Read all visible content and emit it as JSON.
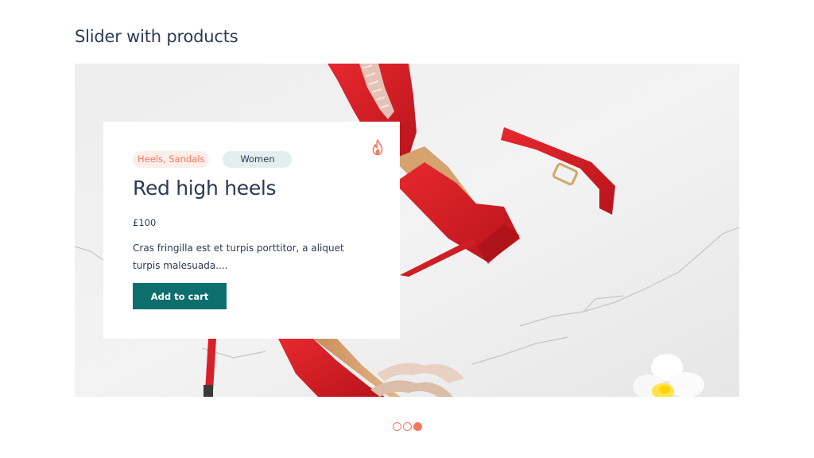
{
  "section": {
    "title": "Slider with products"
  },
  "slide": {
    "image_icon": "red-high-heels-photo",
    "product": {
      "category": "Heels, Sandals",
      "gender": "Women",
      "name": "Red high heels",
      "price": "£100",
      "description": "Cras fringilla est et turpis porttitor, a aliquet turpis malesuada....",
      "hot_icon": "fire-icon",
      "cta_label": "Add to cart"
    }
  },
  "pagination": {
    "total": 3,
    "active_index": 2
  },
  "colors": {
    "accent": "#f07a5e",
    "button": "#0d6e6e",
    "heading": "#2b3a55",
    "category_tag_bg": "#fdeee9",
    "gender_tag_bg": "#e3efef"
  }
}
